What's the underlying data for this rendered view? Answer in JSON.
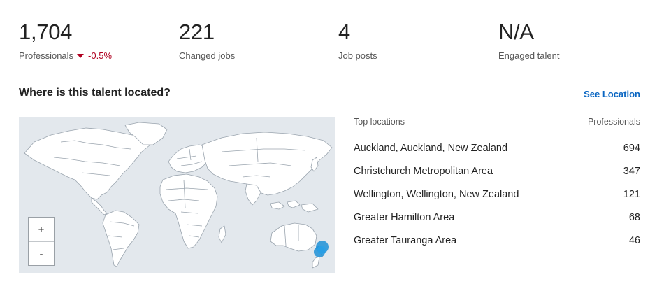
{
  "stats": [
    {
      "value": "1,704",
      "label": "Professionals",
      "delta": "-0.5%"
    },
    {
      "value": "221",
      "label": "Changed jobs"
    },
    {
      "value": "4",
      "label": "Job posts"
    },
    {
      "value": "N/A",
      "label": "Engaged talent"
    }
  ],
  "section": {
    "title": "Where is this talent located?",
    "link": "See Location"
  },
  "map": {
    "zoom_in": "+",
    "zoom_out": "-",
    "ocean_color": "#e3e8ed",
    "land_color": "#ffffff",
    "marker_color": "#1e90d6"
  },
  "locations": {
    "header_name": "Top locations",
    "header_count": "Professionals",
    "rows": [
      {
        "name": "Auckland, Auckland, New Zealand",
        "count": "694"
      },
      {
        "name": "Christchurch Metropolitan Area",
        "count": "347"
      },
      {
        "name": "Wellington, Wellington, New Zealand",
        "count": "121"
      },
      {
        "name": "Greater Hamilton Area",
        "count": "68"
      },
      {
        "name": "Greater Tauranga Area",
        "count": "46"
      }
    ]
  }
}
